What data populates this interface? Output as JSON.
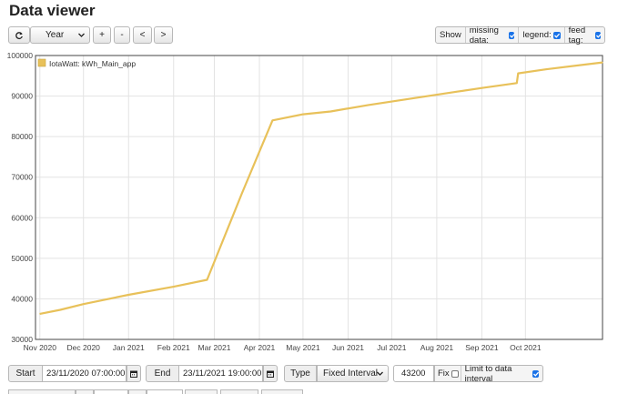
{
  "app": {
    "title": "Data viewer"
  },
  "toolbar": {
    "refresh_icon": "refresh-icon",
    "period": "Year",
    "zoom_in": "+",
    "zoom_out": "-",
    "pan_left": "<",
    "pan_right": ">"
  },
  "options": {
    "show_label": "Show",
    "missing_data_label": "missing data:",
    "missing_data_checked": true,
    "legend_label": "legend:",
    "legend_checked": true,
    "feed_tag_label": "feed tag:",
    "feed_tag_checked": true
  },
  "chart_data": {
    "type": "line",
    "series": [
      {
        "name": "IotaWatt: kWh_Main_app",
        "color": "#e8c15a",
        "points": [
          [
            "2020-11-01",
            36300
          ],
          [
            "2020-11-15",
            37300
          ],
          [
            "2020-12-01",
            38700
          ],
          [
            "2021-01-01",
            41000
          ],
          [
            "2021-02-01",
            43000
          ],
          [
            "2021-02-24",
            44700
          ],
          [
            "2021-03-20",
            66000
          ],
          [
            "2021-04-10",
            84000
          ],
          [
            "2021-05-01",
            85500
          ],
          [
            "2021-05-20",
            86200
          ],
          [
            "2021-06-15",
            87800
          ],
          [
            "2021-07-15",
            89400
          ],
          [
            "2021-08-15",
            91100
          ],
          [
            "2021-09-01",
            92000
          ],
          [
            "2021-09-25",
            93200
          ],
          [
            "2021-09-26",
            95600
          ],
          [
            "2021-10-15",
            96600
          ],
          [
            "2021-11-23",
            98300
          ]
        ]
      }
    ],
    "x_range": [
      "2020-10-29",
      "2021-11-23"
    ],
    "x_ticks": [
      [
        "2020-11-01",
        "Nov 2020"
      ],
      [
        "2020-12-01",
        "Dec 2020"
      ],
      [
        "2021-01-01",
        "Jan 2021"
      ],
      [
        "2021-02-01",
        "Feb 2021"
      ],
      [
        "2021-03-01",
        "Mar 2021"
      ],
      [
        "2021-04-01",
        "Apr 2021"
      ],
      [
        "2021-05-01",
        "May 2021"
      ],
      [
        "2021-06-01",
        "Jun 2021"
      ],
      [
        "2021-07-01",
        "Jul 2021"
      ],
      [
        "2021-08-01",
        "Aug 2021"
      ],
      [
        "2021-09-01",
        "Sep 2021"
      ],
      [
        "2021-10-01",
        "Oct 2021"
      ]
    ],
    "ylim": [
      30000,
      100000
    ],
    "y_ticks": [
      30000,
      40000,
      50000,
      60000,
      70000,
      80000,
      90000,
      100000
    ],
    "grid": true,
    "legend_position": "top-left"
  },
  "controls": {
    "start_label": "Start",
    "start_value": "23/11/2020 07:00:00",
    "end_label": "End",
    "end_value": "23/11/2021 19:00:00",
    "type_label": "Type",
    "type_value": "Fixed Interval",
    "interval_value": "43200",
    "fix_label": "Fix",
    "fix_checked": false,
    "limit_label": "Limit to data interval",
    "limit_checked": true
  }
}
